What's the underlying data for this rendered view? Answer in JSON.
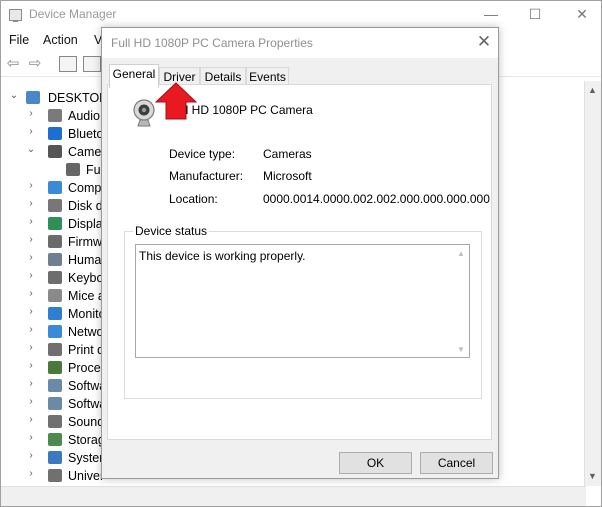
{
  "device_manager": {
    "title": "Device Manager",
    "menu": [
      "File",
      "Action",
      "V"
    ],
    "tree": {
      "root": "DESKTOP-",
      "items": [
        {
          "label": "Audio",
          "expander": "›",
          "color": "#7a7a7a"
        },
        {
          "label": "Blueto",
          "expander": "›",
          "color": "#1c6fd1"
        },
        {
          "label": "Camer",
          "expander": "⌄",
          "color": "#555555"
        },
        {
          "label": "Full",
          "expander": "",
          "color": "#666666"
        },
        {
          "label": "Compu",
          "expander": "›",
          "color": "#3a8ad6"
        },
        {
          "label": "Disk dr",
          "expander": "›",
          "color": "#777777"
        },
        {
          "label": "Display",
          "expander": "›",
          "color": "#2f8f5a"
        },
        {
          "label": "Firmwa",
          "expander": "›",
          "color": "#6b6b6b"
        },
        {
          "label": "Human",
          "expander": "›",
          "color": "#6d7f91"
        },
        {
          "label": "Keyboa",
          "expander": "›",
          "color": "#6d6d6d"
        },
        {
          "label": "Mice a",
          "expander": "›",
          "color": "#8a8a8a"
        },
        {
          "label": "Monito",
          "expander": "›",
          "color": "#2f7fd0"
        },
        {
          "label": "Netwo",
          "expander": "›",
          "color": "#3a8ad6"
        },
        {
          "label": "Print q",
          "expander": "›",
          "color": "#707070"
        },
        {
          "label": "Proces",
          "expander": "›",
          "color": "#4a7a3a"
        },
        {
          "label": "Softwa",
          "expander": "›",
          "color": "#6a8aa8"
        },
        {
          "label": "Softwa",
          "expander": "›",
          "color": "#6a8aa8"
        },
        {
          "label": "Sound",
          "expander": "›",
          "color": "#707070"
        },
        {
          "label": "Storag",
          "expander": "›",
          "color": "#4d8a4d"
        },
        {
          "label": "System",
          "expander": "›",
          "color": "#3a7ac0"
        },
        {
          "label": "Univer",
          "expander": "›",
          "color": "#707070"
        }
      ]
    }
  },
  "dialog": {
    "title": "Full HD 1080P PC Camera Properties",
    "tabs": [
      "General",
      "Driver",
      "Details",
      "Events"
    ],
    "active_tab": "General",
    "device_name": "Full HD 1080P PC Camera",
    "properties": [
      {
        "label": "Device type:",
        "value": "Cameras"
      },
      {
        "label": "Manufacturer:",
        "value": "Microsoft"
      },
      {
        "label": "Location:",
        "value": "0000.0014.0000.002.002.000.000.000.000"
      }
    ],
    "status_legend": "Device status",
    "status_text": "This device is working properly.",
    "ok_label": "OK",
    "cancel_label": "Cancel"
  },
  "annotation": {
    "color": "#e8191f"
  }
}
